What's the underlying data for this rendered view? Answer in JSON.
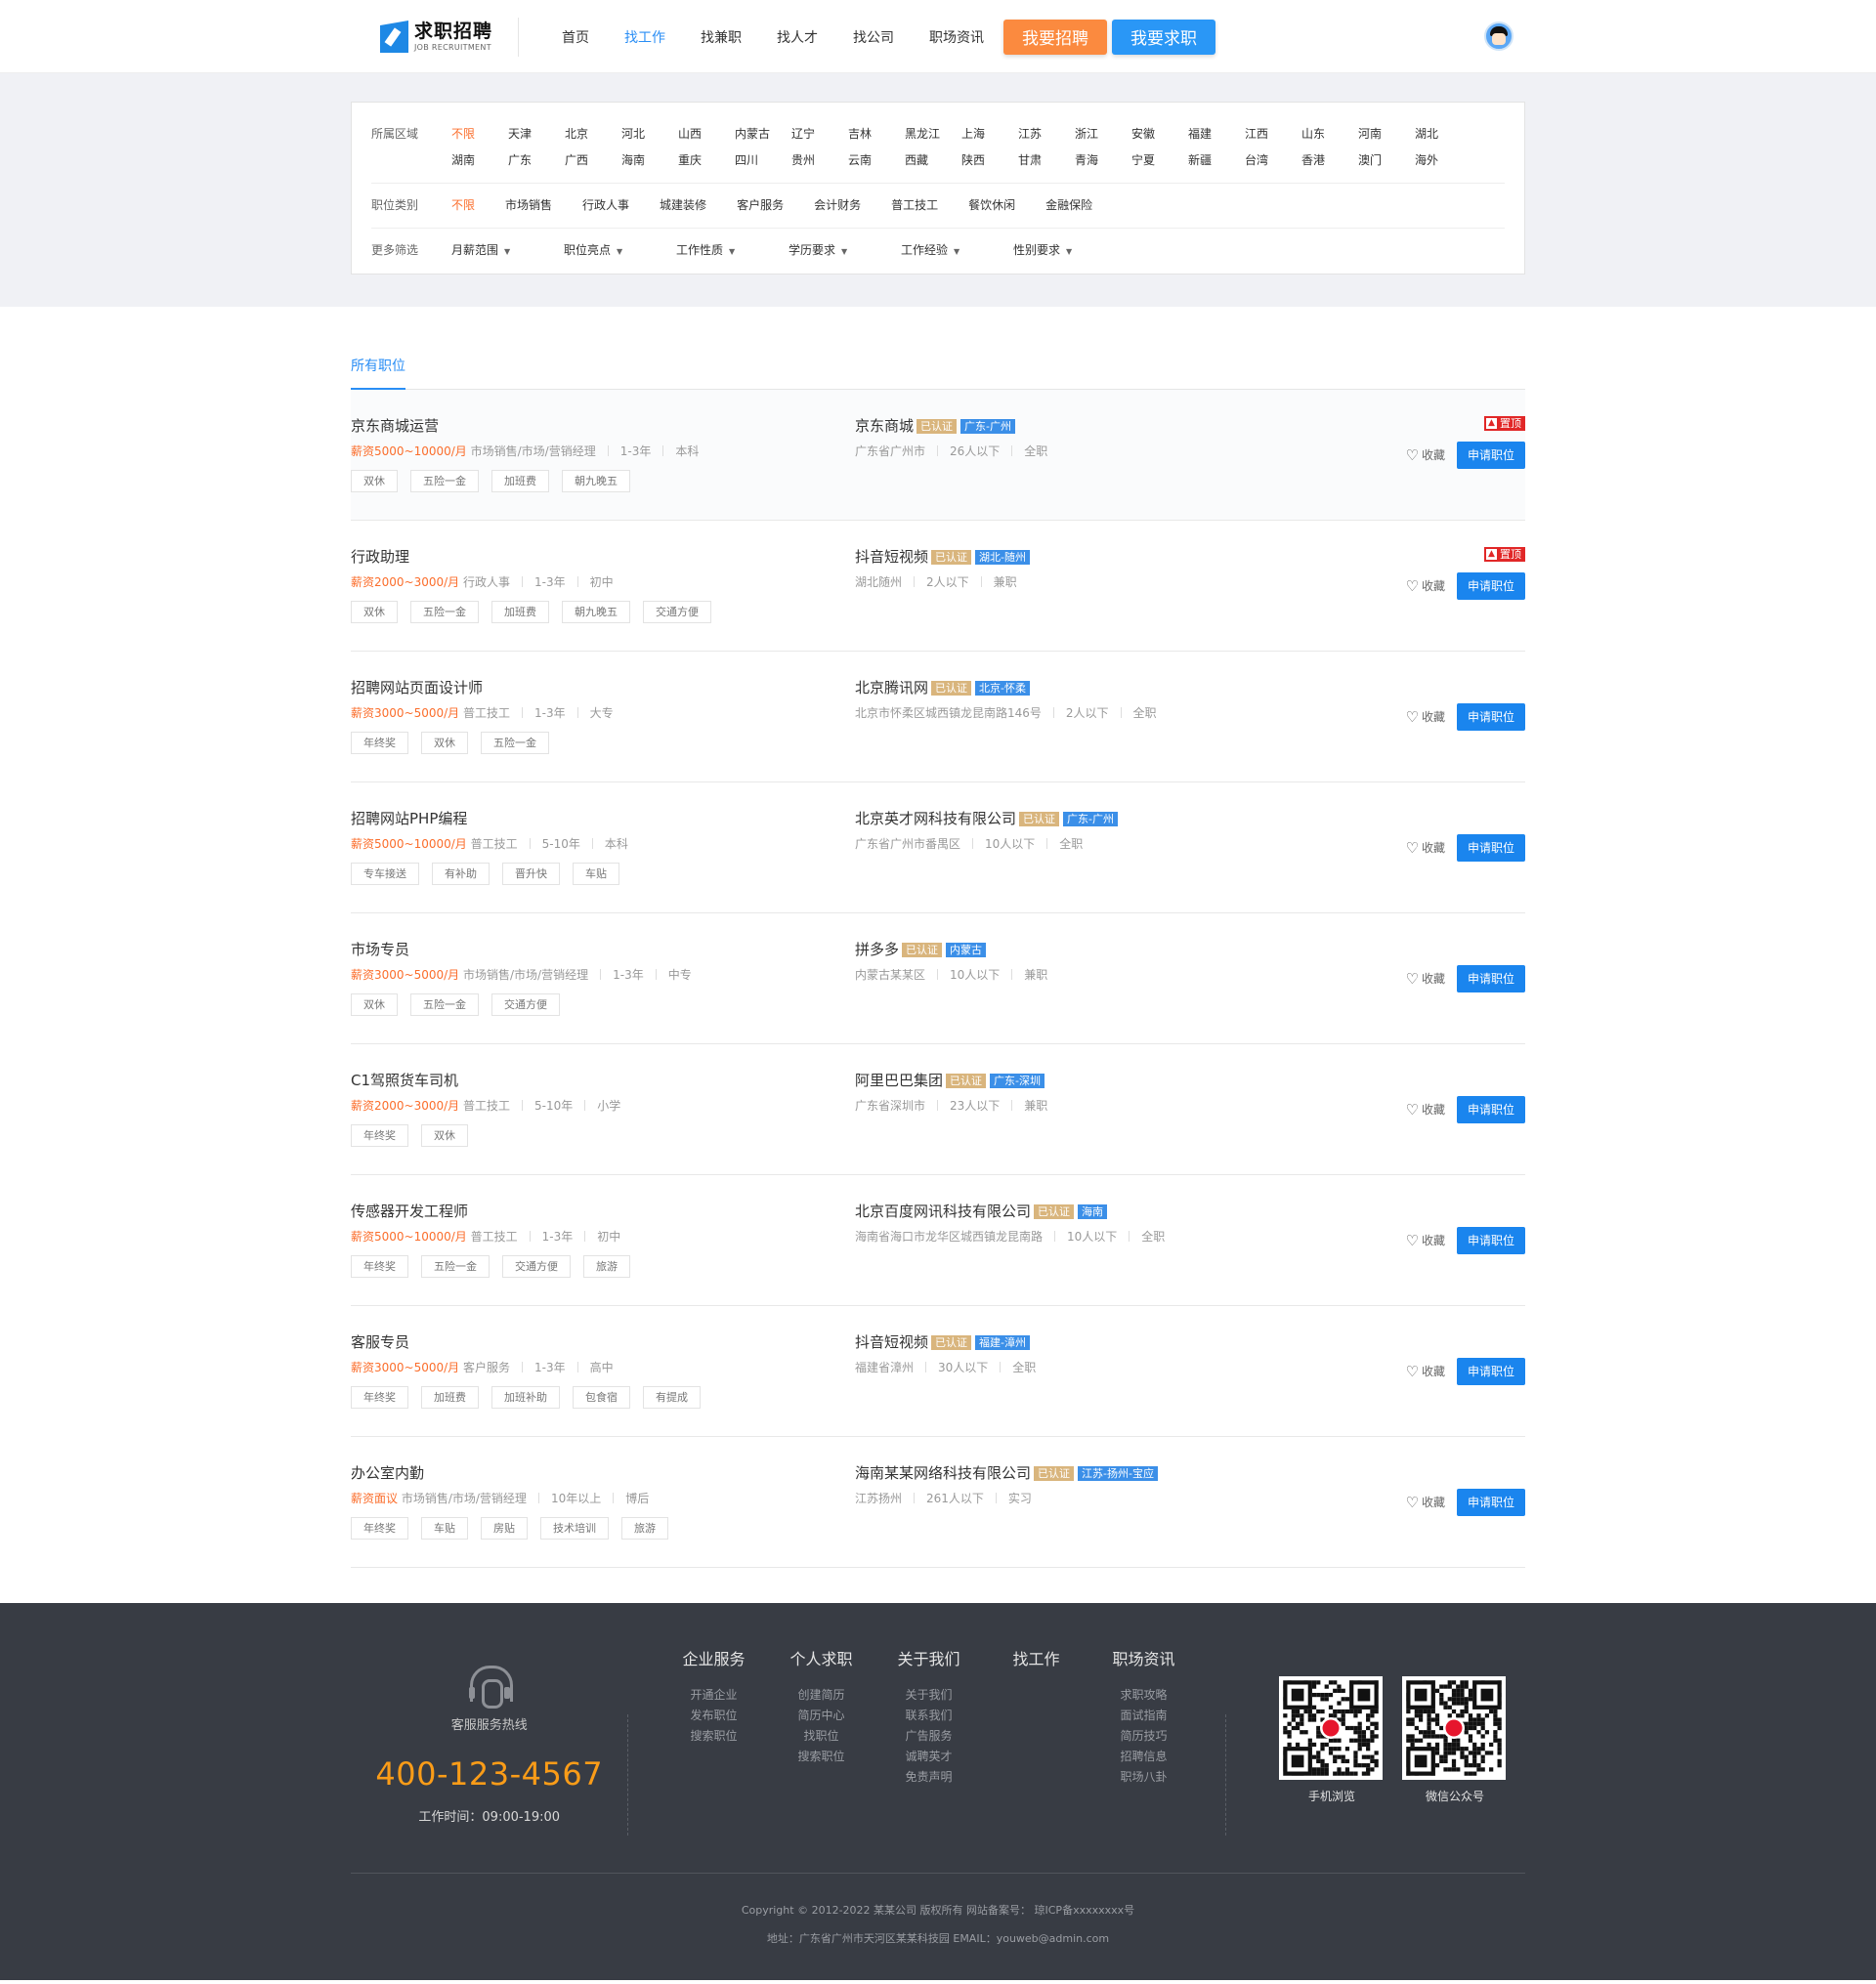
{
  "header": {
    "logo_cn": "求职招聘",
    "logo_en": "JOB RECRUITMENT",
    "nav": [
      "首页",
      "找工作",
      "找兼职",
      "找人才",
      "找公司",
      "职场资讯"
    ],
    "active_nav": "找工作",
    "btn_post": "我要招聘",
    "btn_seek": "我要求职"
  },
  "filters": {
    "region_label": "所属区域",
    "regions": [
      "不限",
      "天津",
      "北京",
      "河北",
      "山西",
      "内蒙古",
      "辽宁",
      "吉林",
      "黑龙江",
      "上海",
      "江苏",
      "浙江",
      "安徽",
      "福建",
      "江西",
      "山东",
      "河南",
      "湖北",
      "湖南",
      "广东",
      "广西",
      "海南",
      "重庆",
      "四川",
      "贵州",
      "云南",
      "西藏",
      "陕西",
      "甘肃",
      "青海",
      "宁夏",
      "新疆",
      "台湾",
      "香港",
      "澳门",
      "海外"
    ],
    "category_label": "职位类别",
    "categories": [
      "不限",
      "市场销售",
      "行政人事",
      "城建装修",
      "客户服务",
      "会计财务",
      "普工技工",
      "餐饮休闲",
      "金融保险"
    ],
    "more_label": "更多筛选",
    "dropdowns": [
      "月薪范围",
      "职位亮点",
      "工作性质",
      "学历要求",
      "工作经验",
      "性别要求"
    ]
  },
  "list": {
    "tab": "所有职位",
    "fav_label": "收藏",
    "apply_label": "申请职位",
    "top_label": "置顶",
    "verified_label": "已认证",
    "jobs": [
      {
        "title": "京东商城运营",
        "salary": "薪资5000~10000/月",
        "category": "市场销售/市场/营销经理",
        "exp": "1-3年",
        "edu": "本科",
        "tags": [
          "双休",
          "五险一金",
          "加班费",
          "朝九晚五"
        ],
        "company": "京东商城",
        "loc_badge": "广东-广州",
        "address": "广东省广州市",
        "size": "26人以下",
        "type": "全职",
        "top": true
      },
      {
        "title": "行政助理",
        "salary": "薪资2000~3000/月",
        "category": "行政人事",
        "exp": "1-3年",
        "edu": "初中",
        "tags": [
          "双休",
          "五险一金",
          "加班费",
          "朝九晚五",
          "交通方便"
        ],
        "company": "抖音短视频",
        "loc_badge": "湖北-随州",
        "address": "湖北随州",
        "size": "2人以下",
        "type": "兼职",
        "top": true
      },
      {
        "title": "招聘网站页面设计师",
        "salary": "薪资3000~5000/月",
        "category": "普工技工",
        "exp": "1-3年",
        "edu": "大专",
        "tags": [
          "年终奖",
          "双休",
          "五险一金"
        ],
        "company": "北京腾讯网",
        "loc_badge": "北京-怀柔",
        "address": "北京市怀柔区城西镇龙昆南路146号",
        "size": "2人以下",
        "type": "全职",
        "top": false
      },
      {
        "title": "招聘网站PHP编程",
        "salary": "薪资5000~10000/月",
        "category": "普工技工",
        "exp": "5-10年",
        "edu": "本科",
        "tags": [
          "专车接送",
          "有补助",
          "晋升快",
          "车贴"
        ],
        "company": "北京英才网科技有限公司",
        "loc_badge": "广东-广州",
        "address": "广东省广州市番禺区",
        "size": "10人以下",
        "type": "全职",
        "top": false
      },
      {
        "title": "市场专员",
        "salary": "薪资3000~5000/月",
        "category": "市场销售/市场/营销经理",
        "exp": "1-3年",
        "edu": "中专",
        "tags": [
          "双休",
          "五险一金",
          "交通方便"
        ],
        "company": "拼多多",
        "loc_badge": "内蒙古",
        "address": "内蒙古某某区",
        "size": "10人以下",
        "type": "兼职",
        "top": false
      },
      {
        "title": "C1驾照货车司机",
        "salary": "薪资2000~3000/月",
        "category": "普工技工",
        "exp": "5-10年",
        "edu": "小学",
        "tags": [
          "年终奖",
          "双休"
        ],
        "company": "阿里巴巴集团",
        "loc_badge": "广东-深圳",
        "address": "广东省深圳市",
        "size": "23人以下",
        "type": "兼职",
        "top": false
      },
      {
        "title": "传感器开发工程师",
        "salary": "薪资5000~10000/月",
        "category": "普工技工",
        "exp": "1-3年",
        "edu": "初中",
        "tags": [
          "年终奖",
          "五险一金",
          "交通方便",
          "旅游"
        ],
        "company": "北京百度网讯科技有限公司",
        "loc_badge": "海南",
        "address": "海南省海口市龙华区城西镇龙昆南路",
        "size": "10人以下",
        "type": "全职",
        "top": false
      },
      {
        "title": "客服专员",
        "salary": "薪资3000~5000/月",
        "category": "客户服务",
        "exp": "1-3年",
        "edu": "高中",
        "tags": [
          "年终奖",
          "加班费",
          "加班补助",
          "包食宿",
          "有提成"
        ],
        "company": "抖音短视频",
        "loc_badge": "福建-漳州",
        "address": "福建省漳州",
        "size": "30人以下",
        "type": "全职",
        "top": false
      },
      {
        "title": "办公室内勤",
        "salary": "薪资面议",
        "category": "市场销售/市场/营销经理",
        "exp": "10年以上",
        "edu": "博后",
        "tags": [
          "年终奖",
          "车贴",
          "房贴",
          "技术培训",
          "旅游"
        ],
        "company": "海南某某网络科技有限公司",
        "loc_badge": "江苏-扬州-宝应",
        "address": "江苏扬州",
        "size": "261人以下",
        "type": "实习",
        "top": false
      }
    ]
  },
  "footer": {
    "hotline_label": "客服服务热线",
    "hotline": "400-123-4567",
    "worktime": "工作时间：09:00-19:00",
    "columns": [
      {
        "title": "企业服务",
        "items": [
          "开通企业",
          "发布职位",
          "搜索职位"
        ]
      },
      {
        "title": "个人求职",
        "items": [
          "创建简历",
          "简历中心",
          "找职位",
          "搜索职位"
        ]
      },
      {
        "title": "关于我们",
        "items": [
          "关于我们",
          "联系我们",
          "广告服务",
          "诚聘英才",
          "免责声明"
        ]
      },
      {
        "title": "找工作",
        "items": []
      },
      {
        "title": "职场资讯",
        "items": [
          "求职攻略",
          "面试指南",
          "简历技巧",
          "招聘信息",
          "职场八卦"
        ]
      }
    ],
    "qr": [
      "手机浏览",
      "微信公众号"
    ],
    "copyright": "Copyright © 2012-2022 某某公司 版权所有 网站备案号： 琼ICP备xxxxxxxx号",
    "address": "地址：广东省广州市天河区某某科技园 EMAIL：youweb@admin.com"
  }
}
